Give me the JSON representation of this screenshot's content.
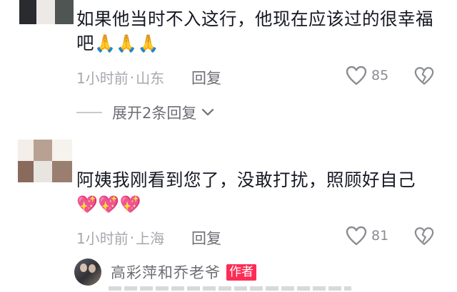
{
  "comments": [
    {
      "text": "如果他当时不入这行，他现在应该过的很幸福吧",
      "emojis": "🙏🙏🙏",
      "time": "1小时前",
      "location": "山东",
      "reply_label": "回复",
      "likes": "85",
      "expand_label": "展开2条回复"
    },
    {
      "text": "阿姨我刚看到您了，没敢打扰，照顾好自己",
      "emojis": "💖💖💖",
      "time": "1小时前",
      "location": "上海",
      "reply_label": "回复",
      "likes": "81"
    }
  ],
  "author_reply": {
    "name": "高彩萍和乔老爷",
    "badge": "作者"
  },
  "icons": {
    "like": "heart-outline-icon",
    "dislike": "broken-heart-icon",
    "expand": "chevron-down-icon"
  },
  "colors": {
    "badge": "#fe2c55",
    "meta": "#a6a8ad",
    "text": "#161823"
  }
}
